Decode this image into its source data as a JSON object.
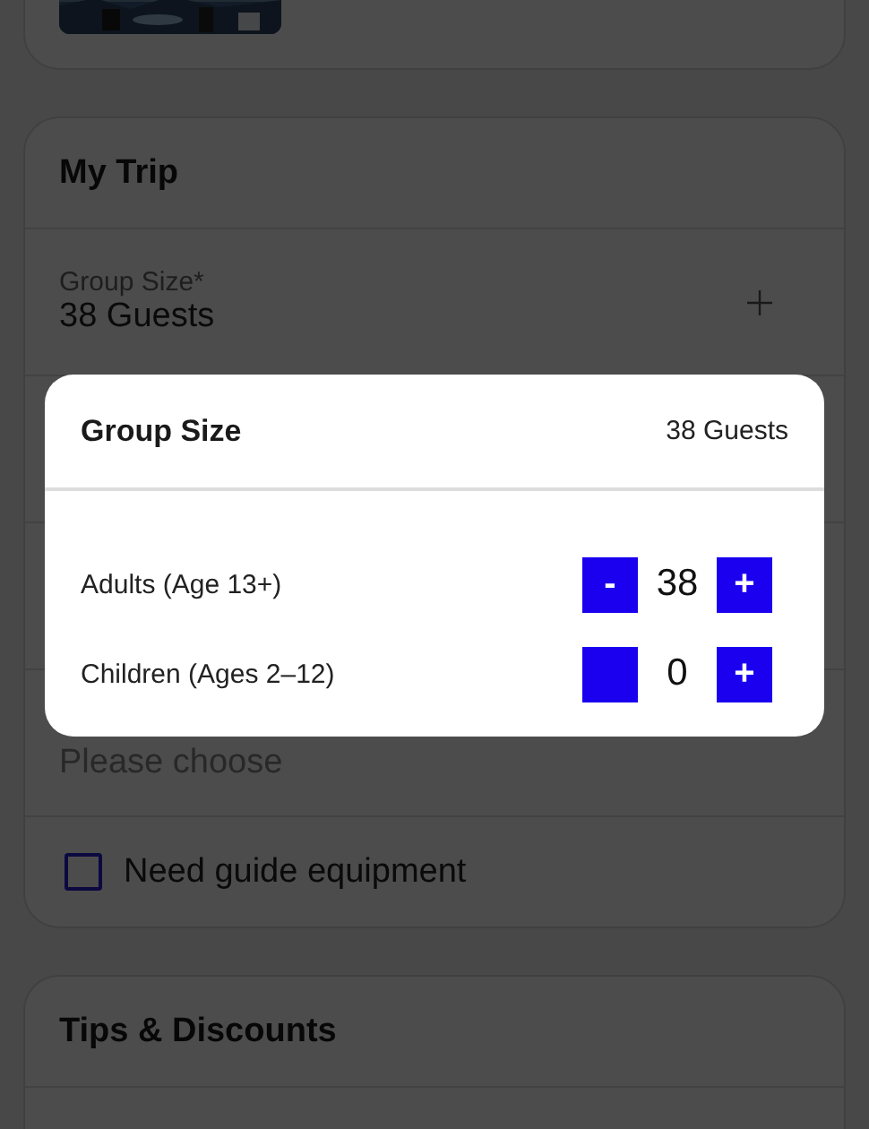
{
  "my_trip": {
    "title": "My Trip",
    "group_size": {
      "label": "Group Size*",
      "value": "38 Guests"
    },
    "destination": {
      "placeholder": "Please choose"
    },
    "guide_equipment": {
      "label": "Need guide equipment",
      "checked": false
    }
  },
  "tips_card": {
    "title": "Tips & Discounts"
  },
  "modal": {
    "title": "Group Size",
    "summary": "38 Guests",
    "rows": [
      {
        "label": "Adults (Age 13+)",
        "count": "38",
        "minus": "-",
        "plus": "+"
      },
      {
        "label": "Children (Ages 2–12)",
        "count": "0",
        "plus": "+"
      }
    ]
  }
}
